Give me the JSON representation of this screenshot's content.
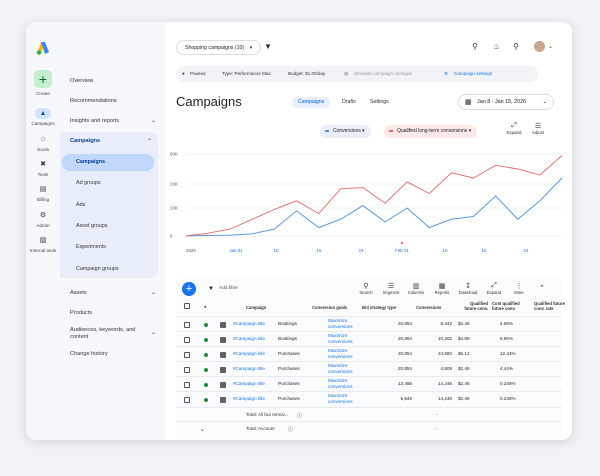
{
  "rail": {
    "create_label": "Create",
    "items": [
      {
        "label": "Campaigns",
        "icon": "campaigns-icon",
        "active": true
      },
      {
        "label": "Goals",
        "icon": "trophy-icon"
      },
      {
        "label": "Tools",
        "icon": "tools-icon"
      },
      {
        "label": "Billing",
        "icon": "credit-card-icon"
      },
      {
        "label": "Admin",
        "icon": "gear-icon"
      },
      {
        "label": "Internal tools",
        "icon": "lock-icon"
      }
    ]
  },
  "sidebar": {
    "overview": "Overview",
    "recommendations": "Recommendations",
    "insights": "Insights and reports",
    "campaigns": "Campaigns",
    "sub": [
      "Campaigns",
      "Ad groups",
      "Ads",
      "Asset groups",
      "Experiments",
      "Campaign groups"
    ],
    "assets": "Assets",
    "products": "Products",
    "audiences": "Audiences, keywords, and content",
    "change_history": "Change history"
  },
  "topbar": {
    "selector": "Shopping campaigns (10)"
  },
  "status": {
    "paused": "Paused",
    "type": "Type: Performance Max",
    "budget": "Budget: $1.00/day",
    "simulate": "Simulate campaign changes",
    "settings": "Campaign settings"
  },
  "page": {
    "title": "Campaigns",
    "tabs": [
      "Campaigns",
      "Drafts",
      "Settings"
    ],
    "date_range": "Jan 8 - Jan 15, 2026"
  },
  "metrics": {
    "m1": "Conversions",
    "m2": "Qualified long-term conversions",
    "expand": "Expand",
    "adjust": "Adjust"
  },
  "colors": {
    "m1": "#4a8fd8",
    "m2": "#e06a6a",
    "accent": "#1a73e8"
  },
  "chart_data": {
    "type": "line",
    "y_ticks": [
      "60K",
      "20K",
      "10K",
      "0"
    ],
    "x_ticks": [
      "2026",
      "Jan 01",
      "10",
      "15",
      "24",
      "Feb 01",
      "10",
      "15",
      "24"
    ],
    "ylim": [
      0,
      60000
    ],
    "series": [
      {
        "name": "Conversions",
        "values": [
          0,
          200,
          300,
          800,
          2500,
          9000,
          3000,
          6000,
          11000,
          5000,
          10000,
          3000,
          6000,
          7000,
          15000,
          6000,
          13000,
          28000
        ]
      },
      {
        "name": "Qualified long-term conversions",
        "values": [
          0,
          1000,
          2500,
          6000,
          9500,
          13000,
          8000,
          18000,
          18500,
          12000,
          23000,
          16000,
          35000,
          28000,
          45000,
          40000,
          32000,
          58000
        ]
      }
    ]
  },
  "toolbar": {
    "filter": "Add filter",
    "buttons": [
      {
        "label": "Search",
        "icon": "search-icon"
      },
      {
        "label": "Segment",
        "icon": "segment-icon"
      },
      {
        "label": "Columns",
        "icon": "columns-icon"
      },
      {
        "label": "Reports",
        "icon": "reports-icon"
      },
      {
        "label": "Download",
        "icon": "download-icon"
      },
      {
        "label": "Expand",
        "icon": "expand-icon"
      },
      {
        "label": "More",
        "icon": "more-icon"
      }
    ]
  },
  "table": {
    "headers": [
      "Campaign",
      "Conversion goals",
      "Bid strategy type",
      "Conversions",
      "Qualified future conv.",
      "Cost qualified future conv.",
      "Qualified future conv. rate"
    ],
    "rows": [
      {
        "name": "#Campaign title",
        "goal": "Bookings",
        "bid": "Maximize conversions",
        "conv": "20,854",
        "qual": "8,442",
        "cost": "$2.46",
        "rate": "4.56%"
      },
      {
        "name": "#Campaign title",
        "goal": "Bookings",
        "bid": "Maximize conversions",
        "conv": "20,854",
        "qual": "10,202",
        "cost": "$4.88",
        "rate": "6.86%"
      },
      {
        "name": "#Campaign title",
        "goal": "Purchases",
        "bid": "Maximize conversions",
        "conv": "20,854",
        "qual": "24,680",
        "cost": "$6.12",
        "rate": "12.44%"
      },
      {
        "name": "#Campaign title",
        "goal": "Purchases",
        "bid": "Maximize conversions",
        "conv": "20,854",
        "qual": "4,806",
        "cost": "$2.46",
        "rate": "4.44%"
      },
      {
        "name": "#Campaign title",
        "goal": "Purchases",
        "bid": "Maximize conversions",
        "conv": "12,468",
        "qual": "14,246",
        "cost": "$2.46",
        "rate": "0.246%"
      },
      {
        "name": "#Campaign title",
        "goal": "Purchases",
        "bid": "Maximize conversions",
        "conv": "5,846",
        "qual": "14,246",
        "cost": "$2.46",
        "rate": "0.246%"
      }
    ],
    "total_all": "Total: All but remov...",
    "total_account": "Total: Account",
    "dash": "-"
  }
}
